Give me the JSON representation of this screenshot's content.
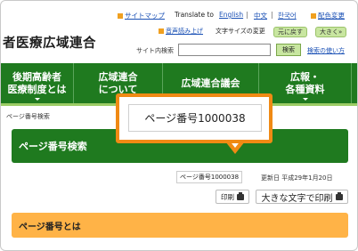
{
  "utility": {
    "sitemap": "サイトマップ",
    "translate_label": "Translate to",
    "english": "English",
    "chinese": "中文",
    "korean": "한국어",
    "color_change": "配色変更"
  },
  "row2": {
    "voice_read": "音声読み上げ",
    "text_size_label": "文字サイズの変更",
    "text_reset": "元に戻す",
    "text_larger": "大きく»"
  },
  "header": {
    "site_title": "者医療広域連合"
  },
  "search": {
    "label": "サイト内検索",
    "input_value": "",
    "button": "検索",
    "help": "検索の使い方"
  },
  "nav": {
    "items": [
      {
        "label": "後期高齢者\n医療制度とは"
      },
      {
        "label": "広域連合\nについて"
      },
      {
        "label": "広域連合議会"
      },
      {
        "label": "広報・\n各種資料"
      }
    ]
  },
  "breadcrumb": "ページ番号検索",
  "page_heading": "ページ番号検索",
  "page_number": "ページ番号1000038",
  "updated": "更新日 平成29年1月20日",
  "print": {
    "print_label": "印刷",
    "large_print_label": "大きな文字で印刷"
  },
  "section_heading": "ページ番号とは",
  "callout": {
    "text": "ページ番号1000038"
  },
  "colors": {
    "nav_green": "#1f7a1f",
    "accent_orange": "#f08a14",
    "section_orange": "#ffb347"
  }
}
